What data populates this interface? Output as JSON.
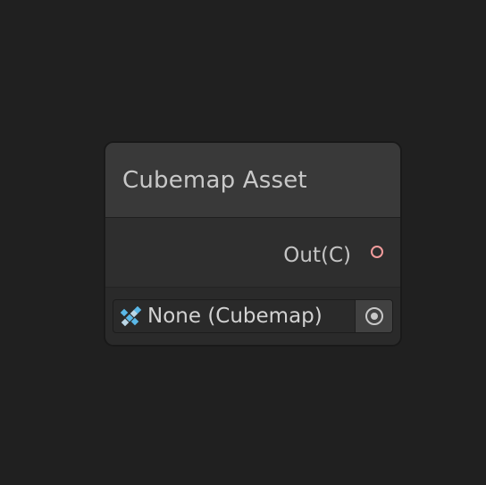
{
  "node": {
    "title": "Cubemap Asset",
    "output_port": {
      "label": "Out(C)",
      "color": "#f29c9c"
    },
    "object_field": {
      "value": "None (Cubemap)",
      "type_icon": "cubemap-icon",
      "picker_icon": "object-picker-icon"
    }
  },
  "colors": {
    "background": "#202020",
    "node_header": "#393939",
    "node_body": "#2b2b2b",
    "port_color": "#f29c9c",
    "icon_accent": "#5ab8e8"
  }
}
